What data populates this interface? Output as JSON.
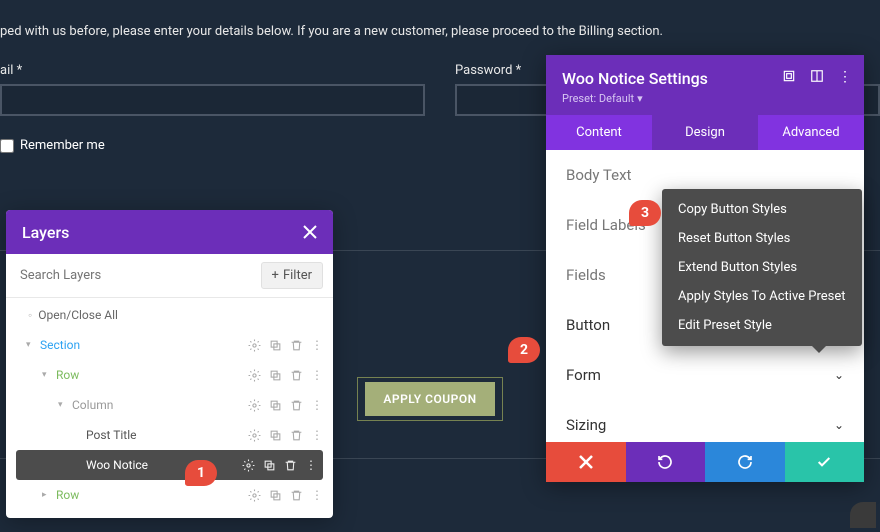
{
  "form": {
    "intro": "ped with us before, please enter your details below. If you are a new customer, please proceed to the Billing section.",
    "email_label": "ail *",
    "password_label": "Password *",
    "remember_label": "Remember me",
    "coupon_button": "APPLY COUPON"
  },
  "layers": {
    "title": "Layers",
    "search_placeholder": "Search Layers",
    "filter_label": "Filter",
    "open_close_all": "Open/Close All",
    "tree": {
      "section": "Section",
      "row1": "Row",
      "column": "Column",
      "post_title": "Post Title",
      "woo_notice": "Woo Notice",
      "row2": "Row"
    }
  },
  "settings": {
    "title": "Woo Notice Settings",
    "preset": "Preset: Default",
    "tabs": {
      "content": "Content",
      "design": "Design",
      "advanced": "Advanced"
    },
    "items": {
      "body_text": "Body Text",
      "field_labels": "Field Labels",
      "fields": "Fields",
      "button": "Button",
      "form": "Form",
      "sizing": "Sizing"
    }
  },
  "ctx": {
    "copy": "Copy Button Styles",
    "reset": "Reset Button Styles",
    "extend": "Extend Button Styles",
    "apply": "Apply Styles To Active Preset",
    "edit": "Edit Preset Style"
  },
  "callouts": {
    "c1": "1",
    "c2": "2",
    "c3": "3"
  }
}
